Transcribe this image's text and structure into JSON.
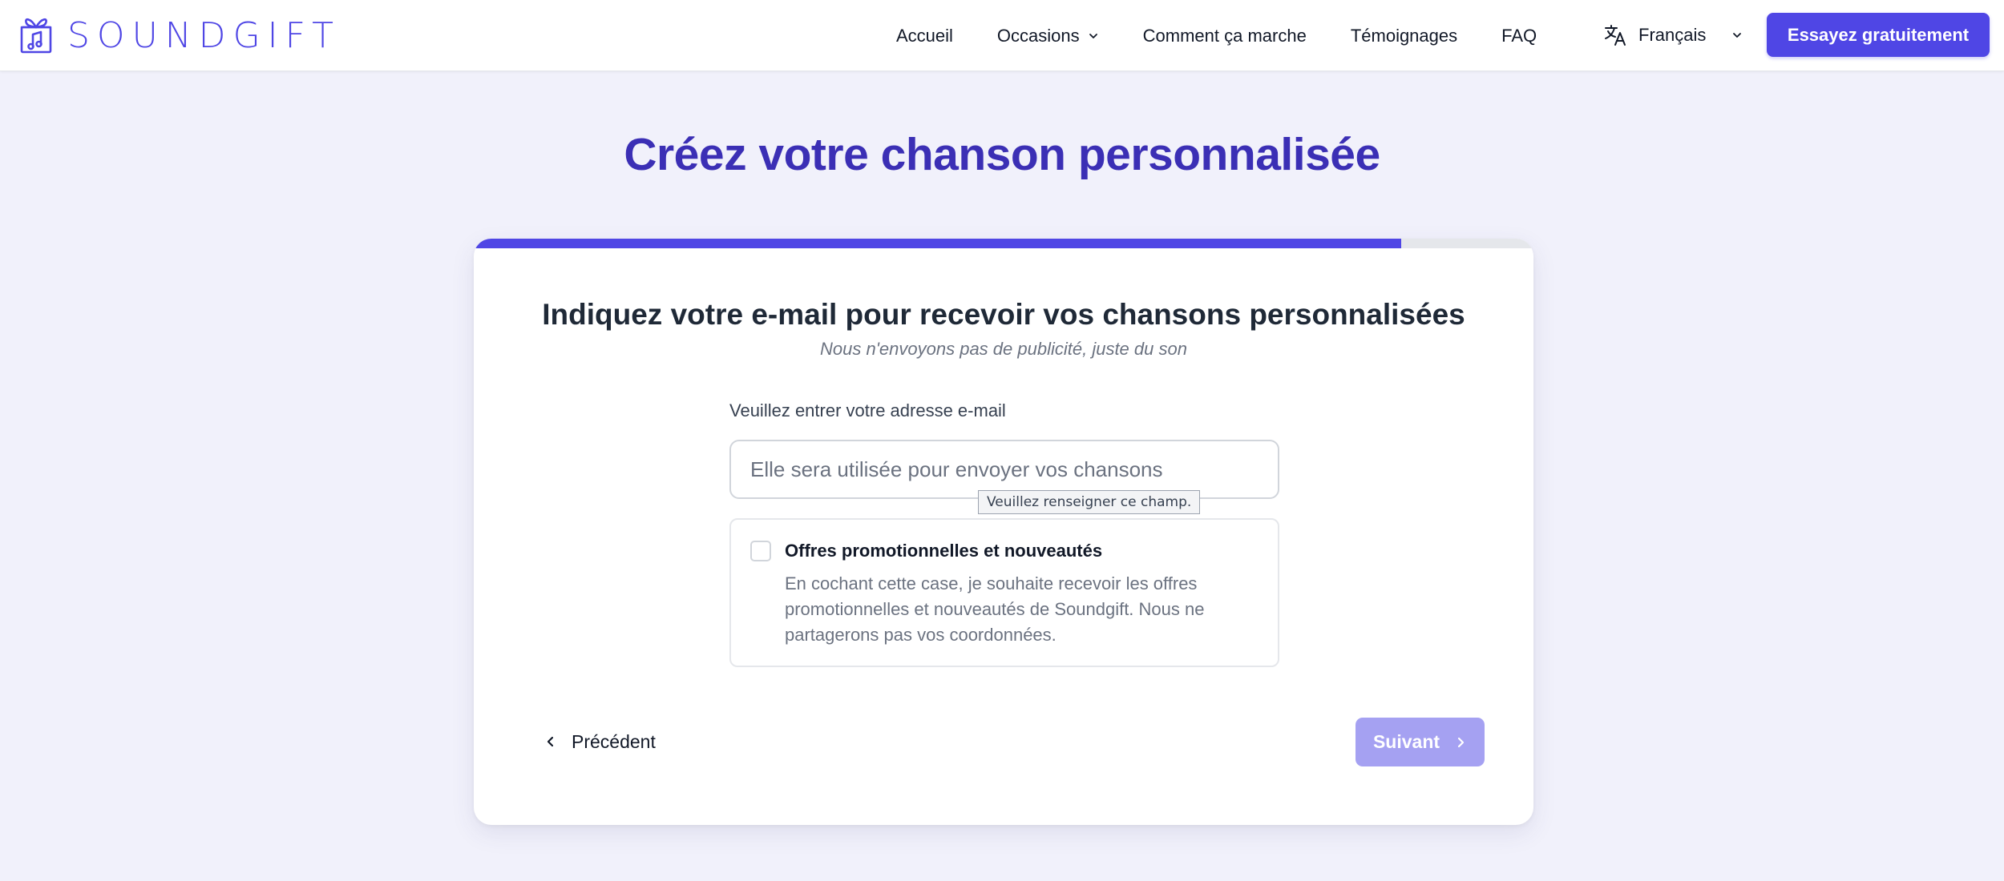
{
  "brand": {
    "name": "SOUNDGIFT",
    "logo_icon": "gift-music-note-icon",
    "accent_color": "#4f46e5"
  },
  "nav": {
    "items": [
      {
        "label": "Accueil",
        "has_dropdown": false
      },
      {
        "label": "Occasions",
        "has_dropdown": true
      },
      {
        "label": "Comment ça marche",
        "has_dropdown": false
      },
      {
        "label": "Témoignages",
        "has_dropdown": false
      },
      {
        "label": "FAQ",
        "has_dropdown": false
      }
    ],
    "language": {
      "label": "Français",
      "icon": "translate-icon"
    },
    "cta_label": "Essayez gratuitement"
  },
  "page": {
    "title": "Créez votre chanson personnalisée"
  },
  "form": {
    "progress_fraction": 0.875,
    "question_title": "Indiquez votre e-mail pour recevoir vos chansons personnalisées",
    "question_subtitle": "Nous n'envoyons pas de publicité, juste du son",
    "email_label": "Veuillez entrer votre adresse e-mail",
    "email_value": "",
    "email_placeholder": "Elle sera utilisée pour envoyer vos chansons",
    "validation_tooltip": "Veuillez renseigner ce champ.",
    "option": {
      "checked": false,
      "title": "Offres promotionnelles et nouveautés",
      "description": "En cochant cette case, je souhaite recevoir les offres promotionnelles et nouveautés de Soundgift. Nous ne partagerons pas vos coordonnées."
    },
    "prev_label": "Précédent",
    "next_label": "Suivant",
    "next_disabled_color": "#a5a1f2"
  }
}
